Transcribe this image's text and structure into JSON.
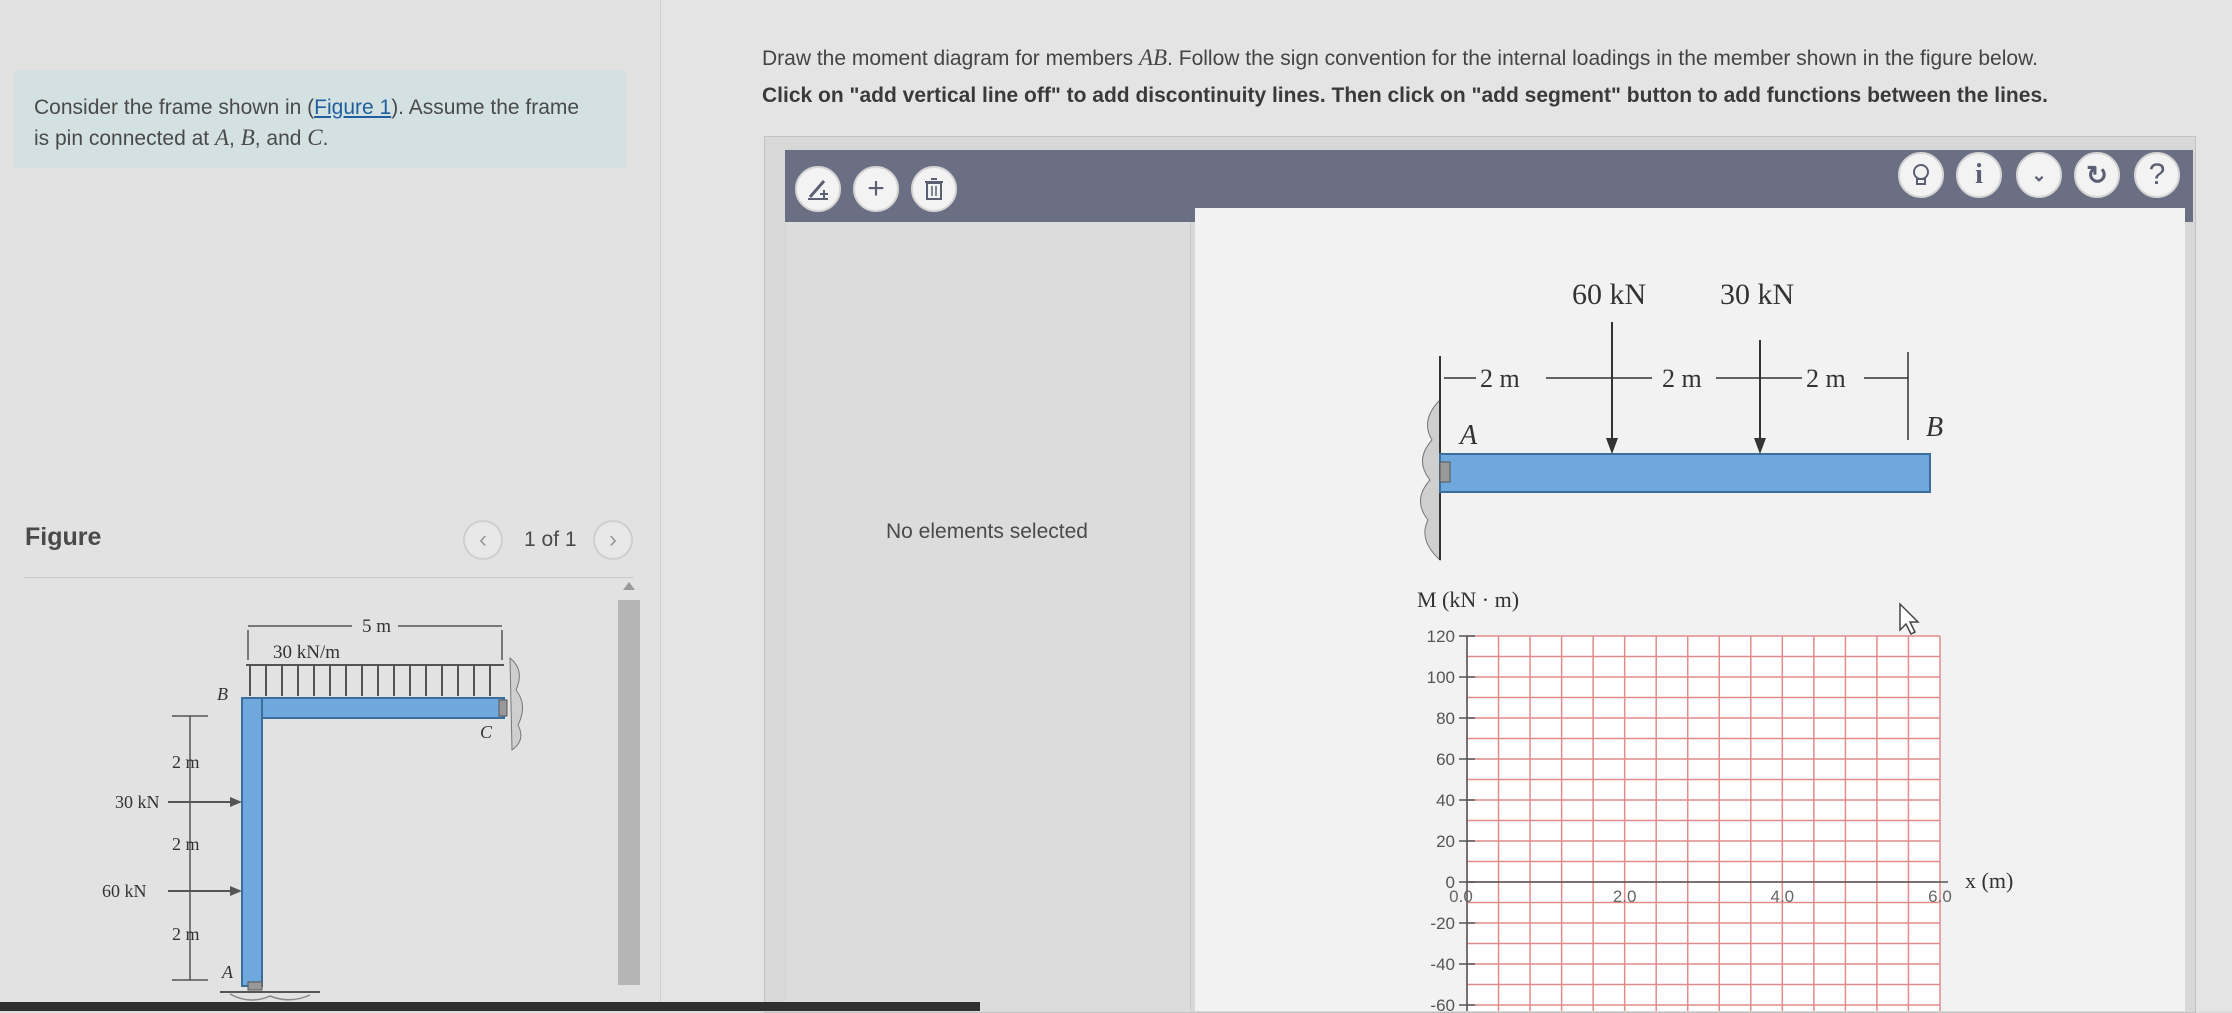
{
  "problem": {
    "text_before_link": "Consider the frame shown in (",
    "link": "Figure 1",
    "text_after_link": "). Assume the frame",
    "line2_prefix": "is pin connected at ",
    "pt_A": "A",
    "pt_B": "B",
    "pt_C": "C",
    "sep": ", ",
    "and": ", and ",
    "end": "."
  },
  "figure_panel": {
    "label": "Figure",
    "counter": "1 of 1",
    "prev_icon": "chevron-left-icon",
    "next_icon": "chevron-right-icon"
  },
  "frame_figure": {
    "span": "5 m",
    "load": "30 kN/m",
    "label_B": "B",
    "label_C": "C",
    "label_A": "A",
    "dim1": "2 m",
    "dim2": "2 m",
    "dim3": "2 m",
    "force1": "30 kN",
    "force2": "60 kN"
  },
  "instructions": {
    "line1_before": "Draw the moment diagram for members ",
    "member": "AB",
    "line1_after": ". Follow the sign convention for the internal loadings in the member shown in the figure below.",
    "line2": "Click on \"add vertical line off\" to add discontinuity lines. Then click on \"add segment\" button to add functions between the lines."
  },
  "toolbar": {
    "icons": [
      "add-vertical-line-icon",
      "add-segment-icon",
      "trash-icon"
    ],
    "right_icons": [
      "hint-icon",
      "info-icon",
      "chevron-down-icon",
      "reset-icon",
      "help-icon"
    ]
  },
  "side_panel": {
    "status": "No elements selected"
  },
  "beam_figure": {
    "load1": "60 kN",
    "load2": "30 kN",
    "seg1": "2 m",
    "seg2": "2 m",
    "seg3": "2 m",
    "label_A": "A",
    "label_B": "B"
  },
  "chart_data": {
    "type": "line",
    "ylabel": "M (kN · m)",
    "xlabel": "x (m)",
    "y_ticks": [
      120,
      100,
      80,
      60,
      40,
      20,
      0,
      -20,
      -40,
      -60
    ],
    "x_ticks": [
      "0.0",
      "2.0",
      "4.0",
      "6.0"
    ],
    "ylim": [
      -60,
      120
    ],
    "xlim": [
      0,
      6
    ],
    "grid": true,
    "grid_color": "#e38a8a",
    "series": []
  },
  "colors": {
    "toolbar": "#6b6f83",
    "problem_bg": "#d3e1e2",
    "beam_blue": "#6fa8dc",
    "link": "#1f5f9e"
  }
}
